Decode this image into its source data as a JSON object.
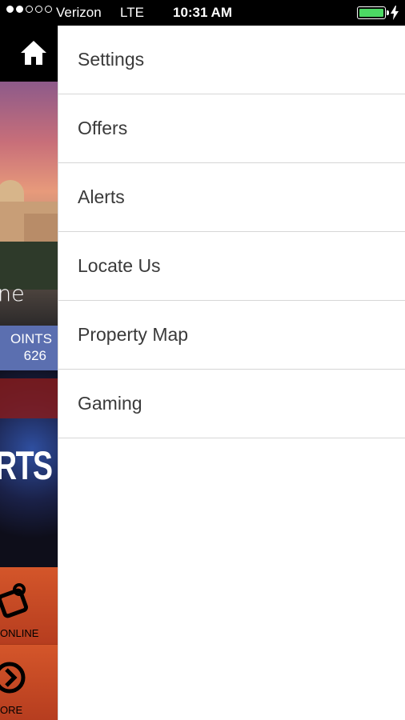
{
  "status_bar": {
    "carrier": "Verizon",
    "network": "LTE",
    "time": "10:31 AM",
    "signal_filled": 2,
    "signal_total": 5,
    "battery_level": 1.0,
    "battery_color": "#4cd964"
  },
  "left_panel": {
    "home_icon": "home-icon",
    "hero_script": "ne",
    "points_label": "OINTS",
    "points_value": "626",
    "alerts_text": "RTS",
    "tile1_label": "ONLINE",
    "tile2_label": "ORE"
  },
  "menu": {
    "items": [
      {
        "label": "Settings"
      },
      {
        "label": "Offers"
      },
      {
        "label": "Alerts"
      },
      {
        "label": "Locate Us"
      },
      {
        "label": "Property Map"
      },
      {
        "label": "Gaming"
      }
    ]
  },
  "colors": {
    "points_bg": "#5b6fb0",
    "tile_orange": "#d4562a",
    "menu_text": "#3a3a3a",
    "divider": "#d6d6d6"
  }
}
